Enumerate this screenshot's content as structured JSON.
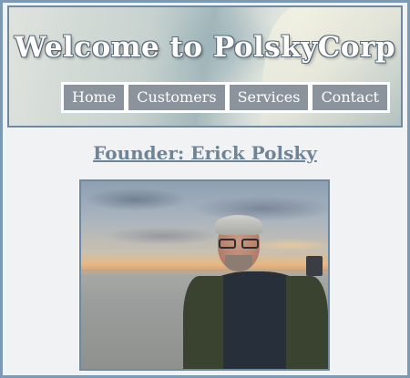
{
  "header": {
    "title": "Welcome to PolskyCorp"
  },
  "nav": {
    "items": [
      {
        "label": "Home"
      },
      {
        "label": "Customers"
      },
      {
        "label": "Services"
      },
      {
        "label": "Contact"
      }
    ]
  },
  "main": {
    "heading": "Founder: Erick Polsky"
  },
  "colors": {
    "border": "#7d9ab4",
    "nav_bg": "#8b939c",
    "heading": "#6f8496",
    "page_bg": "#f0f2f4"
  }
}
